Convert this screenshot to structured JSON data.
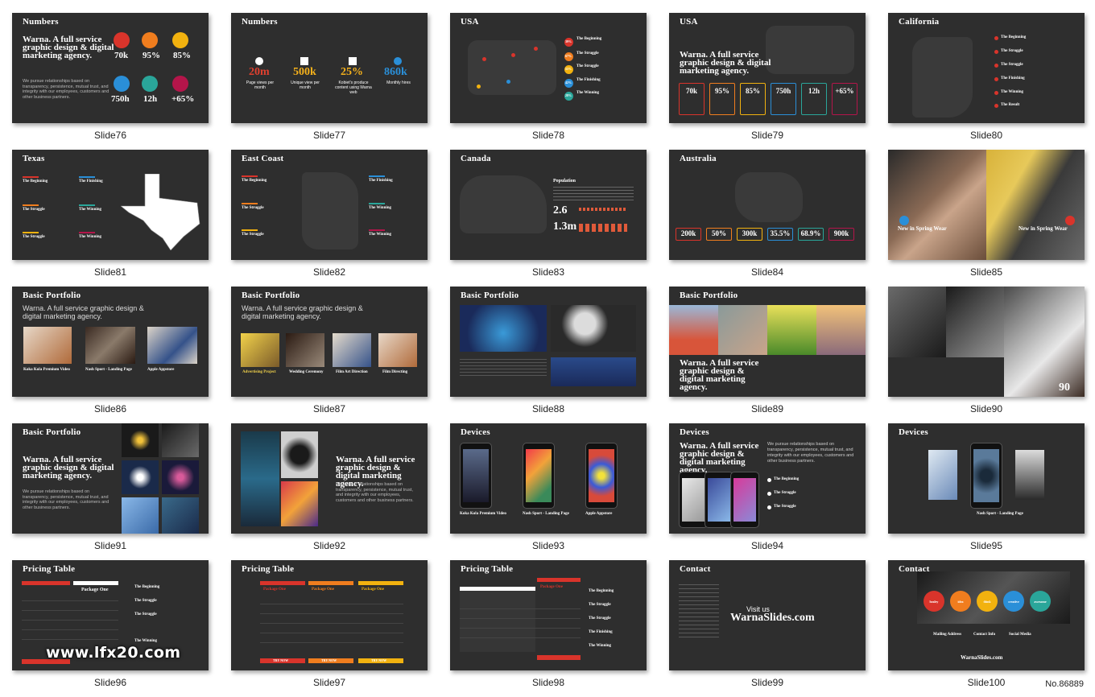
{
  "slides": [
    {
      "label": "Slide76",
      "title": "Numbers",
      "subtitle": "Warna. A full service graphic design & digital marketing agency.",
      "body": "We pursue relationships based on transparency, persistence, mutual trust, and integrity with our employees, customers and other business partners.",
      "stats": [
        "70k",
        "95%",
        "85%",
        "750h",
        "12h",
        "+65%"
      ],
      "stat_colors": [
        "#d9342b",
        "#f07d1e",
        "#f2b20f",
        "#2a8fd8",
        "#2aa69a",
        "#b4154a"
      ]
    },
    {
      "label": "Slide77",
      "title": "Numbers",
      "stats": [
        "20m",
        "500k",
        "25%",
        "860k"
      ],
      "stat_captions": [
        "Page views per month",
        "Unique view per month",
        "Kobiet's produce content using Warna web",
        "Monthly hires"
      ],
      "stat_colors": [
        "#e0402f",
        "#f5b11b",
        "#f5b11b",
        "#2a8fd8"
      ]
    },
    {
      "label": "Slide78",
      "title": "USA",
      "legend": [
        "The Beginning",
        "The Struggle",
        "The Struggle",
        "The Finishing",
        "The Winning"
      ],
      "legend_values": [
        "39%",
        "67%",
        "55%",
        "42%",
        "28%"
      ],
      "legend_colors": [
        "#d9342b",
        "#f07d1e",
        "#f2b20f",
        "#2a8fd8",
        "#2aa69a"
      ]
    },
    {
      "label": "Slide79",
      "title": "USA",
      "subtitle": "Warna. A full service graphic design & digital marketing agency.",
      "stats": [
        "70k",
        "95%",
        "85%",
        "750h",
        "12h",
        "+65%"
      ],
      "stat_colors": [
        "#d9342b",
        "#f07d1e",
        "#f2b20f",
        "#2a8fd8",
        "#2aa69a",
        "#b4154a"
      ]
    },
    {
      "label": "Slide80",
      "title": "California",
      "legend": [
        "The Beginning",
        "The Struggle",
        "The Struggle",
        "The Finishing",
        "The Winning",
        "The Result"
      ],
      "legend_colors": [
        "#d9342b",
        "#d9342b",
        "#d9342b",
        "#d9342b",
        "#d9342b",
        "#d9342b"
      ]
    },
    {
      "label": "Slide81",
      "title": "Texas",
      "legend": [
        "The Beginning",
        "The Finishing",
        "The Struggle",
        "The Winning",
        "The Struggle",
        "The Winning"
      ],
      "legend_colors": [
        "#d9342b",
        "#2a8fd8",
        "#f07d1e",
        "#2aa69a",
        "#f2b20f",
        "#b4154a"
      ]
    },
    {
      "label": "Slide82",
      "title": "East Coast",
      "legend": [
        "The Beginning",
        "The Finishing",
        "The Struggle",
        "The Winning",
        "The Struggle",
        "The Winning"
      ],
      "legend_colors": [
        "#d9342b",
        "#2a8fd8",
        "#f07d1e",
        "#2aa69a",
        "#f2b20f",
        "#b4154a"
      ]
    },
    {
      "label": "Slide83",
      "title": "Canada",
      "heading": "Population",
      "stats": [
        "2.6",
        "1.3m"
      ]
    },
    {
      "label": "Slide84",
      "title": "Australia",
      "stats": [
        "200k",
        "50%",
        "300k",
        "35.5%",
        "68.9%",
        "900k"
      ],
      "stat_colors": [
        "#d9342b",
        "#f07d1e",
        "#f2b20f",
        "#2a8fd8",
        "#2aa69a",
        "#b4154a"
      ]
    },
    {
      "label": "Slide85",
      "captions": [
        "New in Spring Wear",
        "New in Spring Wear"
      ]
    },
    {
      "label": "Slide86",
      "title": "Basic Portfolio",
      "subtitle": "Warna. A full service graphic design & digital marketing agency.",
      "items": [
        "Koka Kola Premium Video",
        "Nash Sport - Landing Page",
        "Apple Appstore"
      ]
    },
    {
      "label": "Slide87",
      "title": "Basic Portfolio",
      "subtitle": "Warna. A full service graphic design & digital marketing agency.",
      "items": [
        "Advertising Project",
        "Wedding Ceremony",
        "Film Art Direction",
        "Film Directing"
      ]
    },
    {
      "label": "Slide88",
      "title": "Basic Portfolio"
    },
    {
      "label": "Slide89",
      "title": "Basic Portfolio",
      "subtitle": "Warna. A full service graphic design & digital marketing agency."
    },
    {
      "label": "Slide90",
      "page": "90"
    },
    {
      "label": "Slide91",
      "title": "Basic Portfolio",
      "subtitle": "Warna. A full service graphic design & digital marketing agency.",
      "body": "We pursue relationships based on transparency, persistence, mutual trust, and integrity with our employees, customers and other business partners."
    },
    {
      "label": "Slide92",
      "subtitle": "Warna. A full service graphic design & digital marketing agency.",
      "body": "We pursue relationships based on transparency, persistence, mutual trust, and integrity with our employees, customers and other business partners."
    },
    {
      "label": "Slide93",
      "title": "Devices",
      "items": [
        "Koka Kola Premium Video",
        "Nash Sport - Landing Page",
        "Apple Appstore"
      ]
    },
    {
      "label": "Slide94",
      "title": "Devices",
      "subtitle": "Warna. A full service graphic design & digital marketing agency.",
      "body": "We pursue relationships based on transparency, persistence, mutual trust, and integrity with our employees, customers and other business partners.",
      "items": [
        "The Beginning",
        "The Struggle",
        "The Struggle"
      ]
    },
    {
      "label": "Slide95",
      "title": "Devices",
      "items": [
        "Nash Sport - Landing Page"
      ]
    },
    {
      "label": "Slide96",
      "title": "Pricing Table",
      "package": "Package One",
      "items": [
        "The Beginning",
        "The Struggle",
        "The Struggle",
        "The Winning"
      ]
    },
    {
      "label": "Slide97",
      "title": "Pricing Table",
      "packages": [
        "Package One",
        "Package One",
        "Package One"
      ],
      "buttons": [
        "TRY NOW",
        "TRY NOW",
        "TRY NOW"
      ]
    },
    {
      "label": "Slide98",
      "title": "Pricing Table",
      "packages": [
        "Package One",
        "Package One",
        "Package One"
      ],
      "items": [
        "The Beginning",
        "The Struggle",
        "The Struggle",
        "The Finishing",
        "The Winning"
      ]
    },
    {
      "label": "Slide99",
      "title": "Contact",
      "visit": "Visit us",
      "site": "WarnaSlides.com"
    },
    {
      "label": "Slide100",
      "title": "Contact",
      "circles": [
        "healey",
        "idea",
        "think",
        "creative",
        "awesome"
      ],
      "circle_colors": [
        "#d9342b",
        "#f07d1e",
        "#f2b20f",
        "#2a8fd8",
        "#2aa69a"
      ],
      "columns": [
        "Mailing Address",
        "Contact Info",
        "Social Media"
      ],
      "site": "WarnaSlides.com"
    }
  ],
  "watermark": "www.lfx20.com",
  "catalog_no": "No.86889"
}
